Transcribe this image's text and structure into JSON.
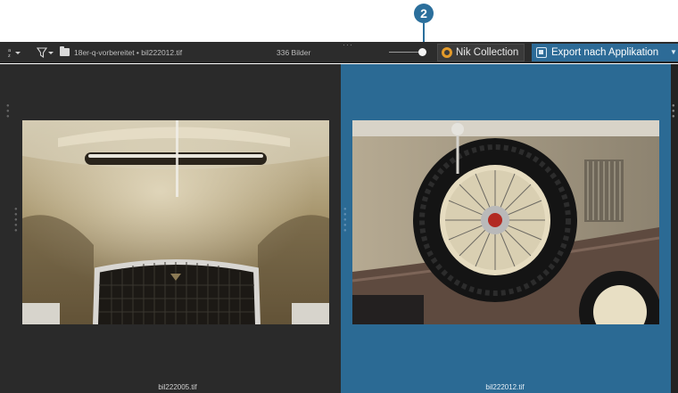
{
  "callout": {
    "number": "2"
  },
  "toolbar": {
    "sort_glyph": "a-z",
    "folder_path": "18er-q-vorbereitet • bil222012.tif",
    "image_count": "336 Bilder",
    "nik_label": "Nik Collection",
    "export_label": "Export nach Applikation"
  },
  "icons": {
    "sort": "sort-az-icon",
    "filter": "filter-icon",
    "folder": "folder-icon",
    "nik": "nik-collection-icon",
    "export": "export-app-icon",
    "caret": "chevron-down-icon"
  },
  "colors": {
    "toolbar_bg": "#2c2c2c",
    "selected_pane": "#2b6a94",
    "accent": "#2d6b97",
    "nik_ring": "#e39a2a"
  },
  "viewer": {
    "left": {
      "caption": "bil222005.tif",
      "selected": false
    },
    "right": {
      "caption": "bil222012.tif",
      "selected": true
    }
  }
}
